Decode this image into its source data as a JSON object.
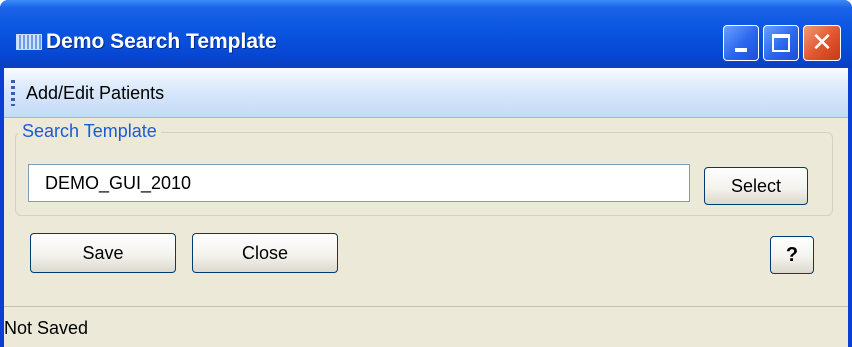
{
  "window": {
    "title": "Demo Search Template",
    "app_icon": "app-grid-icon",
    "controls": {
      "minimize_icon": "minimize-icon",
      "maximize_icon": "maximize-icon",
      "close_glyph": "✕",
      "close_icon": "close-icon"
    }
  },
  "menu": {
    "items": [
      {
        "label": "Add/Edit Patients"
      }
    ]
  },
  "search_template": {
    "group_label": "Search Template",
    "value": "DEMO_GUI_2010",
    "select_label": "Select"
  },
  "actions": {
    "save_label": "Save",
    "close_label": "Close",
    "help_label": "?"
  },
  "status": {
    "text": "Not Saved"
  },
  "colors": {
    "titlebar": "#0a55e0",
    "client_bg": "#ece9d8",
    "group_label": "#1a5cd6",
    "close_button": "#e2542c"
  }
}
